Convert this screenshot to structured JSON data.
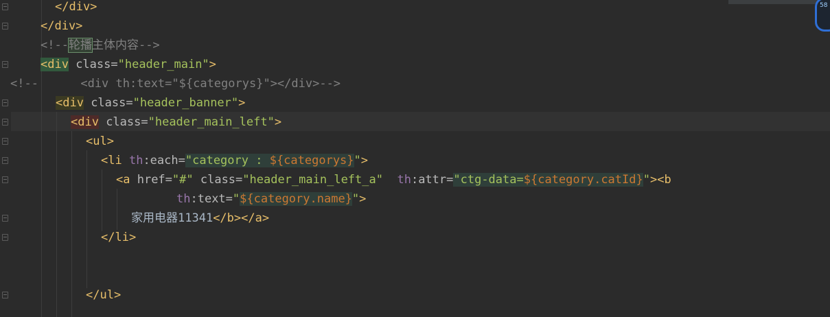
{
  "editor": {
    "lines": [
      {
        "id": "l1",
        "text": "</div>"
      },
      {
        "id": "l2",
        "text": "</div>"
      },
      {
        "id": "l3",
        "prefix": "<!--",
        "highlight": "轮播",
        "rest": "主体内容-->"
      },
      {
        "id": "l4",
        "tag_open": "<div",
        "attr": " class=",
        "value": "\"header_main\"",
        "tag_close": ">"
      },
      {
        "id": "l5",
        "text": "<!--      <div th:text=\"${categorys}\"></div>-->"
      },
      {
        "id": "l6",
        "tag_open": "<div",
        "attr": " class=",
        "value": "\"header_banner\"",
        "tag_close": ">"
      },
      {
        "id": "l7",
        "tag_open": "<div",
        "attr": " class=",
        "value": "\"header_main_left\"",
        "tag_close": ">"
      },
      {
        "id": "l8",
        "text": "<ul>"
      },
      {
        "id": "l9",
        "tag_open": "<li ",
        "th": "th",
        "attr": ":each=",
        "q1": "\"",
        "value": "category : ",
        "expr": "${categorys}",
        "q2": "\"",
        "tag_close": ">"
      },
      {
        "id": "l10",
        "tag_open": "<a",
        "attr1": " href=",
        "value1": "\"#\"",
        "attr2": " class=",
        "value2": "\"header_main_left_a\"",
        "th": "th",
        "attr3": ":attr=",
        "value3a": "\"ctg-data=",
        "expr": "${category.catId}",
        "value3b": "\"",
        "tag_close": "><b"
      },
      {
        "id": "l11",
        "th": "th",
        "attr": ":text=",
        "q1": "\"",
        "expr": "${category.name}",
        "q2": "\"",
        "tag_close": ">"
      },
      {
        "id": "l12",
        "text": "家用电器11341",
        "tag": "</b></a>"
      },
      {
        "id": "l13",
        "text": "</li>"
      },
      {
        "id": "l14",
        "text": ""
      },
      {
        "id": "l15",
        "text": ""
      },
      {
        "id": "l16",
        "text": "</ul>"
      }
    ]
  },
  "badge": {
    "text": "58\n..."
  },
  "colors": {
    "background": "#2b2b2b",
    "tag": "#e8bf6a",
    "string": "#a5c25c",
    "comment": "#808080",
    "thymeleaf": "#9876aa"
  }
}
